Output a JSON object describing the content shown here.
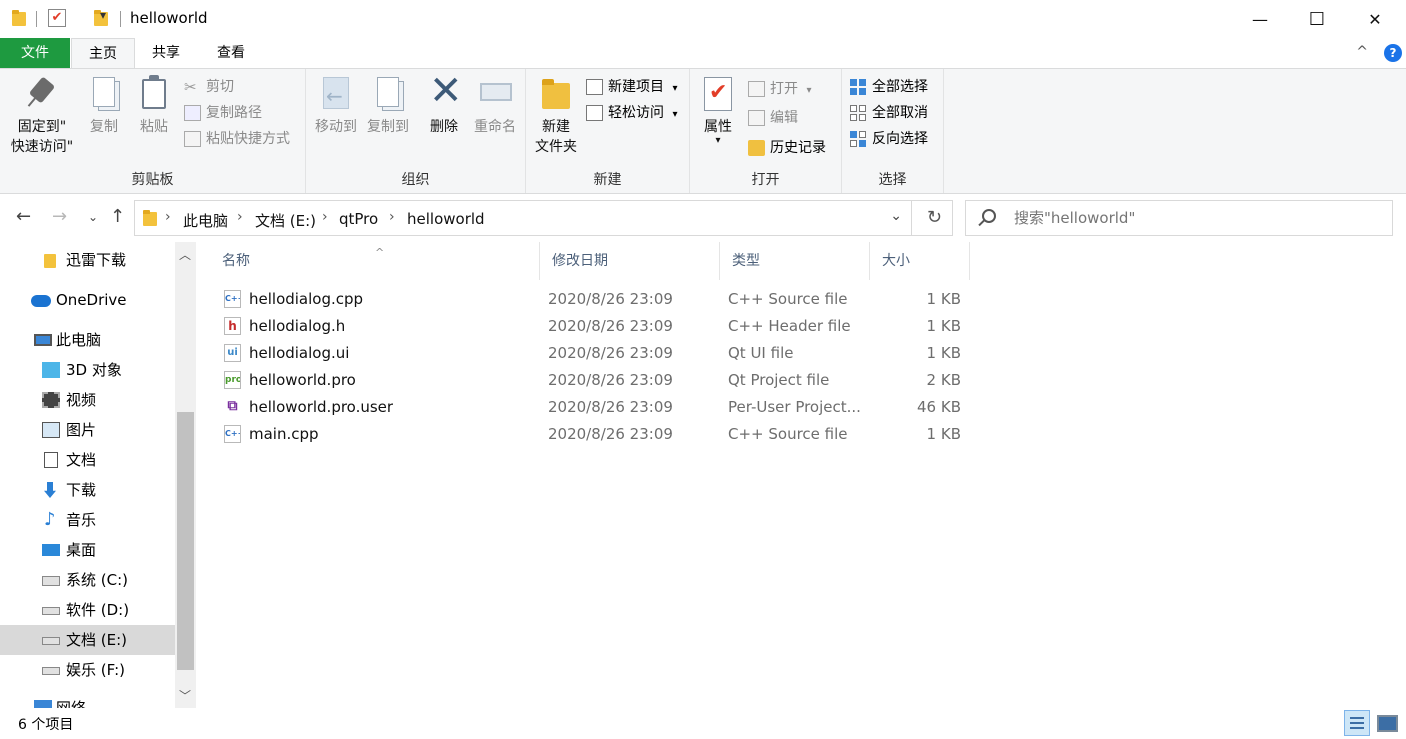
{
  "window": {
    "title": "helloworld",
    "quick_access_dropdown": "▾",
    "minimize": "—",
    "maximize": "☐",
    "close": "✕"
  },
  "ribbon_tabs": {
    "file": "文件",
    "home": "主页",
    "share": "共享",
    "view": "查看",
    "collapse": "^",
    "help": "?"
  },
  "ribbon": {
    "clipboard": {
      "label": "剪贴板",
      "pin_line1": "固定到\"",
      "pin_line2": "快速访问\"",
      "copy": "复制",
      "paste": "粘贴",
      "cut": "剪切",
      "copy_path": "复制路径",
      "paste_shortcut": "粘贴快捷方式"
    },
    "organize": {
      "label": "组织",
      "move_to": "移动到",
      "copy_to": "复制到",
      "delete": "删除",
      "rename": "重命名"
    },
    "new": {
      "label": "新建",
      "new_folder_line1": "新建",
      "new_folder_line2": "文件夹",
      "new_item": "新建项目",
      "easy_access": "轻松访问"
    },
    "open": {
      "label": "打开",
      "properties": "属性",
      "open": "打开",
      "edit": "编辑",
      "history": "历史记录"
    },
    "select": {
      "label": "选择",
      "select_all": "全部选择",
      "select_none": "全部取消",
      "invert": "反向选择"
    }
  },
  "address": {
    "crumbs": [
      "此电脑",
      "文档 (E:)",
      "qtPro",
      "helloworld"
    ],
    "search_placeholder": "搜索\"helloworld\""
  },
  "nav": {
    "items": [
      {
        "label": "迅雷下载",
        "icon": "folder-icon"
      },
      {
        "label": "OneDrive",
        "icon": "onedrive-icon"
      },
      {
        "label": "此电脑",
        "icon": "computer-icon"
      },
      {
        "label": "3D 对象",
        "icon": "3d-objects-icon"
      },
      {
        "label": "视频",
        "icon": "video-icon"
      },
      {
        "label": "图片",
        "icon": "pictures-icon"
      },
      {
        "label": "文档",
        "icon": "documents-icon"
      },
      {
        "label": "下载",
        "icon": "download-icon"
      },
      {
        "label": "音乐",
        "icon": "music-icon"
      },
      {
        "label": "桌面",
        "icon": "desktop-icon"
      },
      {
        "label": "系统 (C:)",
        "icon": "windows-drive-icon"
      },
      {
        "label": "软件 (D:)",
        "icon": "drive-icon"
      },
      {
        "label": "文档 (E:)",
        "icon": "drive-icon"
      },
      {
        "label": "娱乐 (F:)",
        "icon": "drive-icon"
      },
      {
        "label": "网络",
        "icon": "network-icon"
      }
    ]
  },
  "files": {
    "columns": {
      "name": "名称",
      "date": "修改日期",
      "type": "类型",
      "size": "大小"
    },
    "rows": [
      {
        "name": "hellodialog.cpp",
        "date": "2020/8/26 23:09",
        "type": "C++ Source file",
        "size": "1 KB",
        "icon": "cpp"
      },
      {
        "name": "hellodialog.h",
        "date": "2020/8/26 23:09",
        "type": "C++ Header file",
        "size": "1 KB",
        "icon": "h"
      },
      {
        "name": "hellodialog.ui",
        "date": "2020/8/26 23:09",
        "type": "Qt UI file",
        "size": "1 KB",
        "icon": "ui"
      },
      {
        "name": "helloworld.pro",
        "date": "2020/8/26 23:09",
        "type": "Qt Project file",
        "size": "2 KB",
        "icon": "pro"
      },
      {
        "name": "helloworld.pro.user",
        "date": "2020/8/26 23:09",
        "type": "Per-User Project...",
        "size": "46 KB",
        "icon": "user"
      },
      {
        "name": "main.cpp",
        "date": "2020/8/26 23:09",
        "type": "C++ Source file",
        "size": "1 KB",
        "icon": "cpp"
      }
    ]
  },
  "status": {
    "count": "6 个项目"
  },
  "icon_labels": {
    "cpp": "C++",
    "h": "h",
    "ui": "ui",
    "pro": "pro",
    "user": "⧉"
  }
}
